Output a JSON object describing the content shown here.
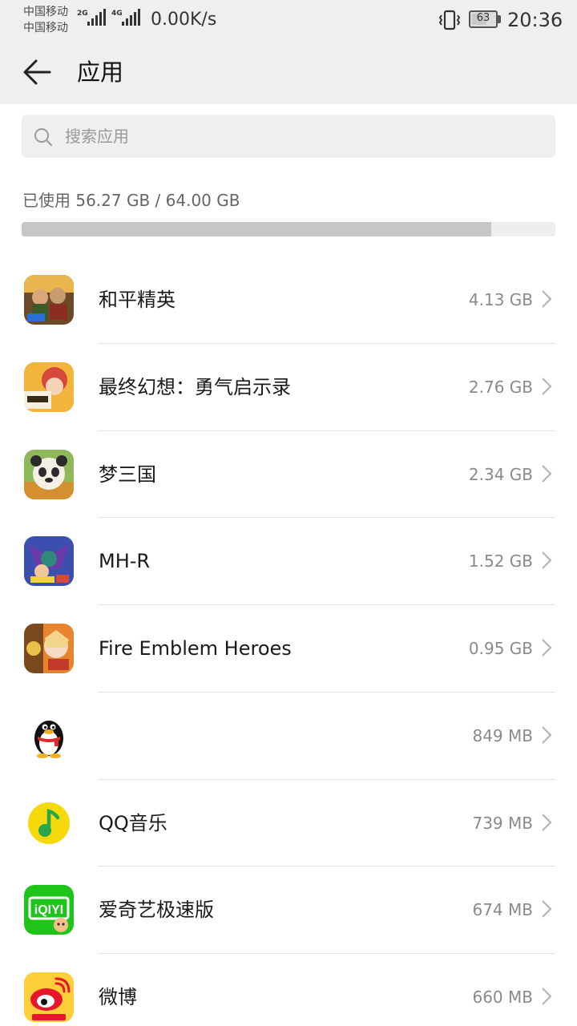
{
  "status_bar": {
    "carrier_1": "中国移动",
    "carrier_2": "中国移动",
    "sim1_tech": "2G",
    "sim2_tech": "4G",
    "net_speed": "0.00K/s",
    "battery": "63",
    "battery_level": 0.63,
    "time": "20:36"
  },
  "header": {
    "title": "应用",
    "back_icon": "back-arrow-icon"
  },
  "search": {
    "placeholder": "搜索应用",
    "value": "",
    "icon": "search-icon"
  },
  "storage": {
    "label": "已使用 56.27 GB / 64.00 GB",
    "used_fraction": 0.8792
  },
  "apps": [
    {
      "name": "和平精英",
      "size": "4.13 GB",
      "icon": "peace-elite-icon"
    },
    {
      "name": "最终幻想：勇气启示录",
      "size": "2.76 GB",
      "icon": "ffbe-icon"
    },
    {
      "name": "梦三国",
      "size": "2.34 GB",
      "icon": "panda-icon"
    },
    {
      "name": "MH-R",
      "size": "1.52 GB",
      "icon": "dragon-icon"
    },
    {
      "name": "Fire Emblem Heroes",
      "size": "0.95 GB",
      "icon": "fire-emblem-icon"
    },
    {
      "name": "",
      "size": "849 MB",
      "icon": "qq-penguin-icon"
    },
    {
      "name": "QQ音乐",
      "size": "739 MB",
      "icon": "qq-music-icon"
    },
    {
      "name": "爱奇艺极速版",
      "size": "674 MB",
      "icon": "iqiyi-icon"
    },
    {
      "name": "微博",
      "size": "660 MB",
      "icon": "weibo-icon"
    }
  ],
  "colors": {
    "bar_bg": "#efefef",
    "storage_fill": "#c6c6c6",
    "iqiyi_green": "#1fc41a",
    "qq_music_yellow": "#f5d90a",
    "weibo_red": "#e6162d"
  }
}
